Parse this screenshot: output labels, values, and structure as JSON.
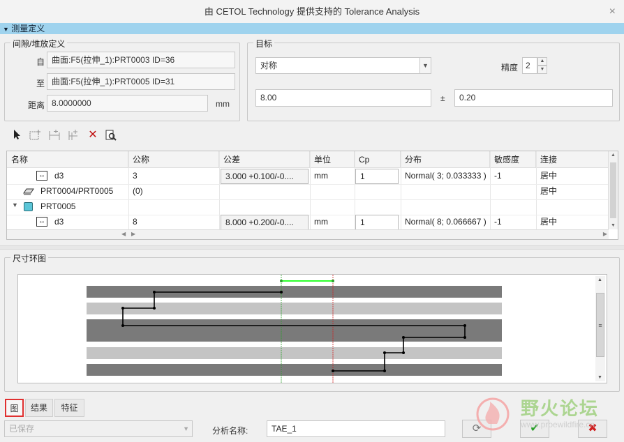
{
  "window": {
    "title": "由 CETOL Technology 提供支持的 Tolerance Analysis",
    "close_glyph": "×"
  },
  "section": {
    "label": "测量定义",
    "toggle_glyph": "▼"
  },
  "clearance": {
    "group_title": "间隙/堆放定义",
    "from_label": "自",
    "from_value": "曲面:F5(拉伸_1):PRT0003 ID=36",
    "to_label": "至",
    "to_value": "曲面:F5(拉伸_1):PRT0005 ID=31",
    "distance_label": "距离",
    "distance_value": "8.0000000",
    "unit": "mm"
  },
  "target": {
    "group_title": "目标",
    "type_selected": "对称",
    "precision_label": "精度",
    "precision_value": "2",
    "nominal": "8.00",
    "pm": "±",
    "tolerance": "0.20"
  },
  "toolbar": {
    "icons": [
      "select-arrow-icon",
      "add-dimension-icon",
      "measure-icon",
      "insert-icon",
      "delete-icon",
      "preview-icon"
    ]
  },
  "table": {
    "headers": [
      "名称",
      "公称",
      "公差",
      "单位",
      "Cp",
      "分布",
      "敏感度",
      "连接"
    ],
    "rows": [
      {
        "name": "d3",
        "nominal": "3",
        "tolerance": "3.000 +0.100/-0....",
        "unit": "mm",
        "cp": "1",
        "distribution": "Normal( 3; 0.033333 )",
        "sensitivity": "-1",
        "link": "居中"
      },
      {
        "name": "PRT0004/PRT0005",
        "nominal": "(0)",
        "tolerance": "",
        "unit": "",
        "cp": "",
        "distribution": "",
        "sensitivity": "",
        "link": "居中"
      },
      {
        "name": "PRT0005",
        "nominal": "",
        "tolerance": "",
        "unit": "",
        "cp": "",
        "distribution": "",
        "sensitivity": "",
        "link": ""
      },
      {
        "name": "d3",
        "nominal": "8",
        "tolerance": "8.000 +0.200/-0....",
        "unit": "mm",
        "cp": "1",
        "distribution": "Normal( 8; 0.066667 )",
        "sensitivity": "-1",
        "link": "居中"
      }
    ]
  },
  "diagram": {
    "group_title": "尺寸环图"
  },
  "tabs": [
    "图",
    "结果",
    "特征"
  ],
  "bottom": {
    "save_state": "已保存",
    "analysis_name_label": "分析名称:",
    "analysis_name": "TAE_1"
  },
  "watermark": {
    "text": "野火论坛",
    "url": "www.proewildfire.cn"
  },
  "colors": {
    "accent_bar": "#9fd3ee",
    "ok_green": "#2aa12a",
    "cancel_red": "#d02020",
    "highlight_tab": "#e03030"
  }
}
